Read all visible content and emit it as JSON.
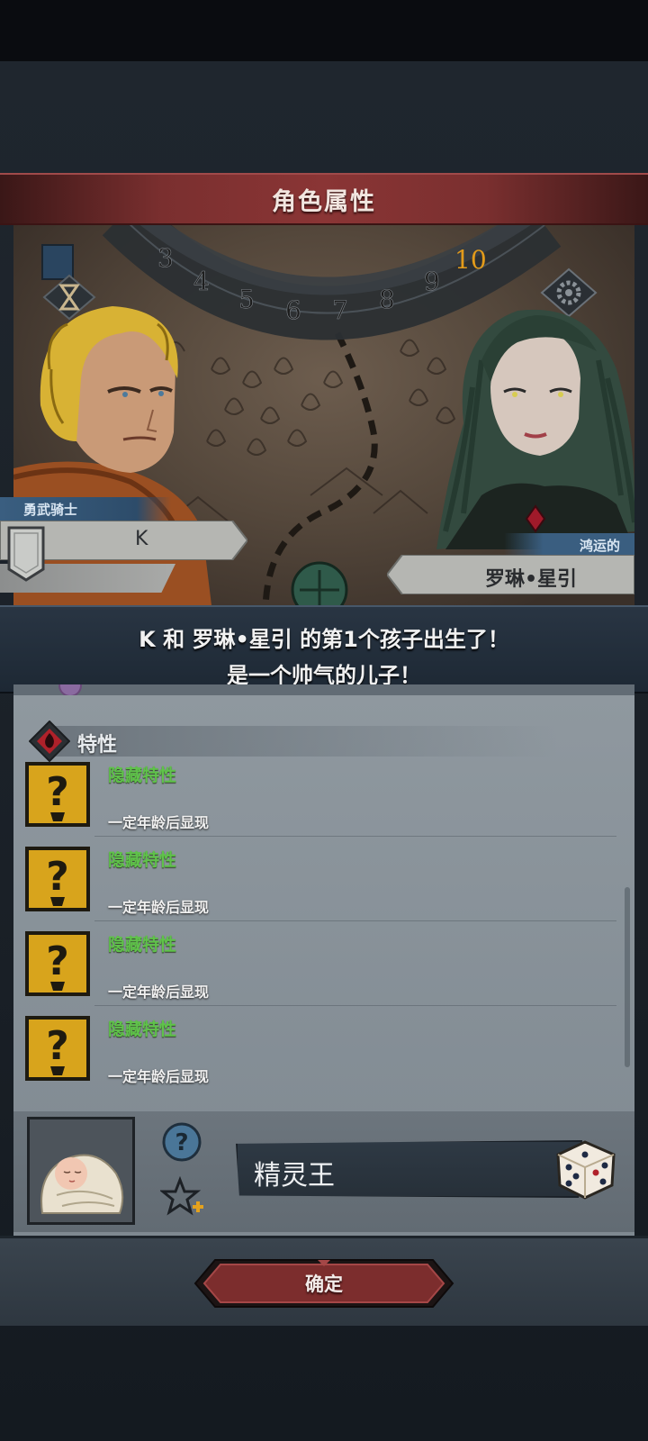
{
  "dialog": {
    "title": "角色属性"
  },
  "father": {
    "title_tag": "勇武骑士",
    "name": "K"
  },
  "mother": {
    "title_tag": "鸿运的",
    "name": "罗琳•星引"
  },
  "map": {
    "timeline_numbers": [
      "3",
      "4",
      "5",
      "6",
      "7",
      "8",
      "9",
      "10"
    ],
    "highlight_number": "10"
  },
  "announcement": {
    "line1": "K 和 罗琳•星引 的第1个孩子出生了！",
    "line2": "是一个帅气的儿子！"
  },
  "traits": {
    "title": "特性",
    "items": [
      {
        "name": "隐藏特性",
        "description": "一定年龄后显现"
      },
      {
        "name": "隐藏特性",
        "description": "一定年龄后显现"
      },
      {
        "name": "隐藏特性",
        "description": "一定年龄后显现"
      },
      {
        "name": "隐藏特性",
        "description": "一定年龄后显现"
      }
    ]
  },
  "child": {
    "name_value": "精灵王"
  },
  "buttons": {
    "confirm": "确定"
  },
  "colors": {
    "header_red": "#8a3535",
    "trait_green": "#5fc24a",
    "message_band": "#293543",
    "panel_gray": "#8f989f"
  }
}
